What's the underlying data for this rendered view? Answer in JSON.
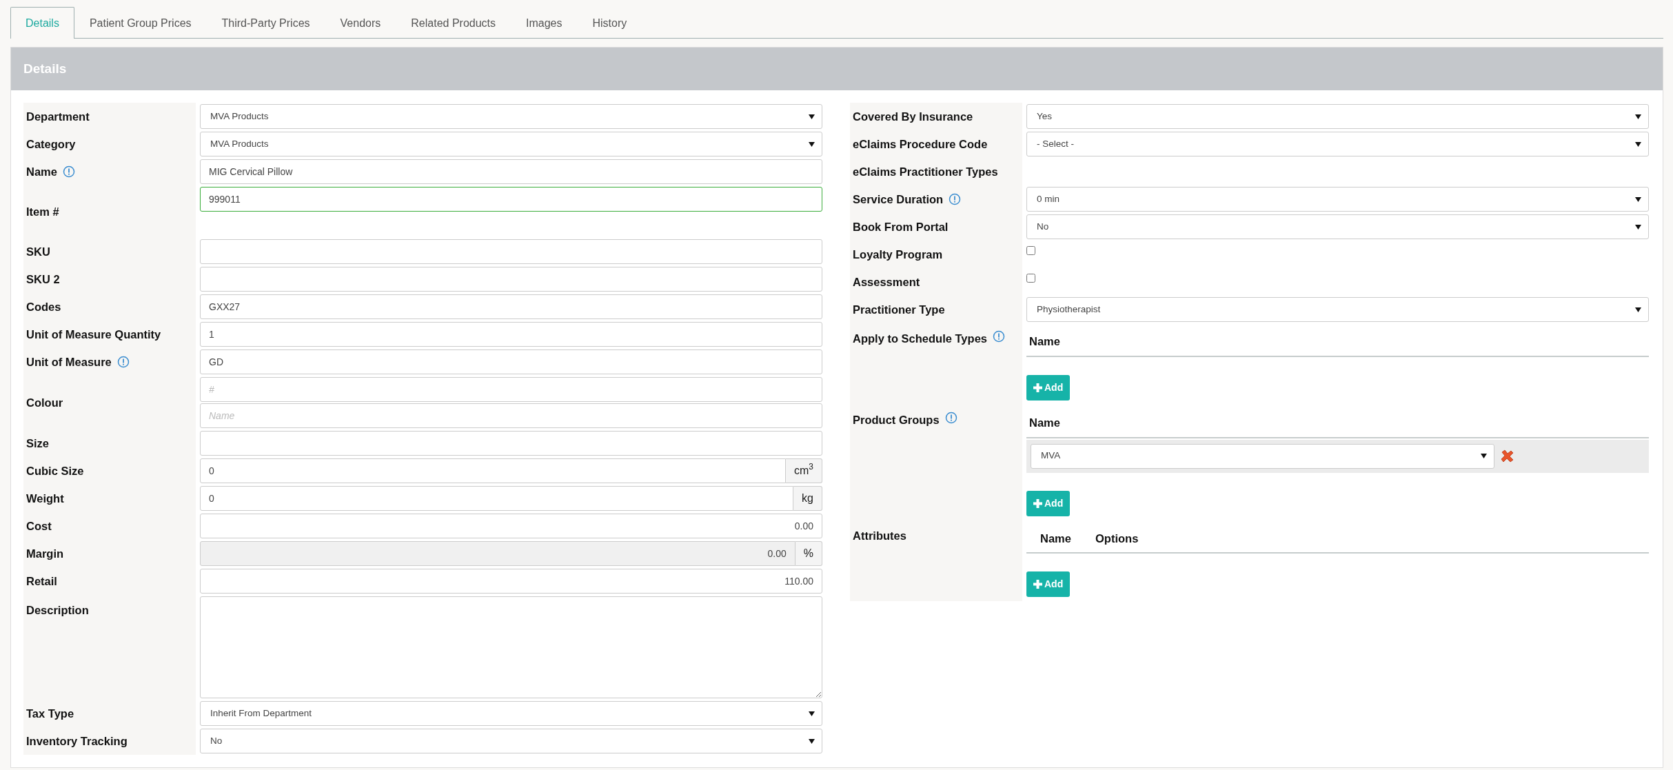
{
  "tabs": [
    {
      "label": "Details",
      "selected": true
    },
    {
      "label": "Patient Group Prices",
      "selected": false
    },
    {
      "label": "Third-Party Prices",
      "selected": false
    },
    {
      "label": "Vendors",
      "selected": false
    },
    {
      "label": "Related Products",
      "selected": false
    },
    {
      "label": "Images",
      "selected": false
    },
    {
      "label": "History",
      "selected": false
    }
  ],
  "panel": {
    "title": "Details"
  },
  "left_fields": [
    {
      "label": "Department",
      "kind": "select",
      "value": "MVA Products",
      "info": false
    },
    {
      "label": "Category",
      "kind": "select",
      "value": "MVA Products",
      "info": false
    },
    {
      "label": "Name",
      "kind": "text",
      "value": "MIG Cervical Pillow",
      "info": true,
      "valid": false,
      "disabled": false
    },
    {
      "label": "Item #",
      "kind": "text",
      "value": "999011",
      "info": false,
      "valid": true,
      "disabled": false
    },
    {
      "label": "SKU",
      "kind": "text",
      "info": false,
      "valid": false,
      "disabled": false
    },
    {
      "label": "SKU 2",
      "kind": "text",
      "info": false,
      "valid": false,
      "disabled": false
    },
    {
      "label": "Codes",
      "kind": "text",
      "value": "GXX27",
      "info": false,
      "valid": false,
      "disabled": false
    },
    {
      "label": "Unit of Measure Quantity",
      "kind": "text",
      "value": "1",
      "info": false,
      "valid": false,
      "disabled": false
    },
    {
      "label": "Unit of Measure",
      "kind": "text",
      "value": "GD",
      "info": true,
      "valid": false,
      "disabled": false
    },
    {
      "label": "Colour",
      "kind": "pair",
      "info": false,
      "inputs": [
        {
          "placeholder": "#"
        },
        {
          "placeholder": "Name"
        }
      ]
    },
    {
      "label": "Size",
      "kind": "text",
      "info": false,
      "valid": false,
      "disabled": false
    },
    {
      "label": "Cubic Size",
      "kind": "text",
      "value": "0",
      "addon": "cm$^{3}$",
      "info": false,
      "valid": false,
      "disabled": false
    },
    {
      "label": "Weight",
      "kind": "text",
      "value": "0",
      "addon": "kg",
      "info": false,
      "valid": false,
      "disabled": false
    },
    {
      "label": "Cost",
      "kind": "number",
      "value": "0.00",
      "info": false,
      "valid": false,
      "disabled": false
    },
    {
      "label": "Margin",
      "kind": "number",
      "value": "0.00",
      "addon": "%",
      "info": false,
      "valid": false,
      "disabled": true
    },
    {
      "label": "Retail",
      "kind": "number",
      "value": "110.00",
      "info": false,
      "valid": false,
      "disabled": false
    },
    {
      "label": "Description",
      "kind": "textarea",
      "info": false
    },
    {
      "label": "Tax Type",
      "kind": "select",
      "value": "Inherit From Department",
      "info": false
    },
    {
      "label": "Inventory Tracking",
      "kind": "select",
      "value": "No",
      "info": false
    }
  ],
  "right_fields": [
    {
      "label": "Covered By Insurance",
      "kind": "select",
      "value": "Yes",
      "info": false
    },
    {
      "label": "eClaims Procedure Code",
      "kind": "select",
      "value": "- Select -",
      "info": false
    },
    {
      "label": "eClaims Practitioner Types",
      "kind": "none",
      "info": false
    },
    {
      "label": "Service Duration",
      "kind": "select",
      "value": "0 min",
      "info": true
    },
    {
      "label": "Book From Portal",
      "kind": "select",
      "value": "No",
      "info": false
    },
    {
      "label": "Loyalty Program",
      "kind": "checkbox",
      "checked": false,
      "info": false
    },
    {
      "label": "Assessment",
      "kind": "checkbox",
      "checked": false,
      "info": false
    },
    {
      "label": "Practitioner Type",
      "kind": "select",
      "value": "Physiotherapist",
      "info": false
    },
    {
      "label": "Apply to Schedule Types",
      "kind": "table",
      "info": true,
      "columns": [
        "Name"
      ],
      "button": "Add"
    },
    {
      "label": "Product Groups",
      "kind": "table",
      "info": true,
      "columns": [
        "Name"
      ],
      "rows": [
        {
          "value": "MVA"
        }
      ],
      "button": "Add"
    },
    {
      "label": "Attributes",
      "kind": "table",
      "info": false,
      "columns": [
        "Name",
        "Options"
      ],
      "button": "Add"
    }
  ]
}
